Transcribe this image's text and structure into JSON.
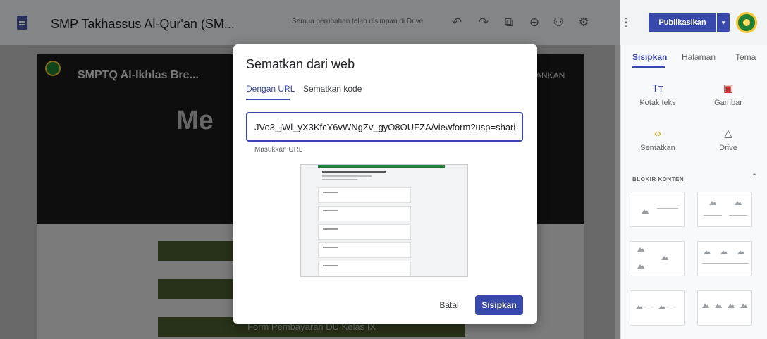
{
  "topbar": {
    "site_title": "SMP Takhassus Al-Qur'an (SM...",
    "save_status": "Semua perubahan telah disimpan di Drive",
    "undo_icon": "↶",
    "redo_icon": "↷",
    "preview_icon": "⧉",
    "link_icon": "⊖",
    "share_icon": "⚇",
    "settings_icon": "⚙",
    "more_icon": "⋮",
    "publish_label": "Publikasikan",
    "publish_dropdown_icon": "▾"
  },
  "site": {
    "header_title": "SMPTQ Al-Ikhlas Bre...",
    "nav_item": "BANKAN",
    "hero_text": "Me",
    "buttons": [
      "",
      "",
      "Form Pembayaran DU Kelas IX"
    ]
  },
  "panel": {
    "tabs": [
      "Sisipkan",
      "Halaman",
      "Tema"
    ],
    "tools": [
      {
        "label": "Kotak teks",
        "icon": "Tт",
        "color": "#3949ab"
      },
      {
        "label": "Gambar",
        "icon": "▣",
        "color": "#c62828"
      },
      {
        "label": "Sematkan",
        "icon": "‹›",
        "color": "#e6a100"
      },
      {
        "label": "Drive",
        "icon": "△",
        "color": "#5f6368"
      }
    ],
    "section_title": "BLOKIR KONTEN",
    "section_chevron": "⌃"
  },
  "dialog": {
    "title": "Sematkan dari web",
    "tab_url": "Dengan URL",
    "tab_code": "Sematkan kode",
    "url_value": "JVo3_jWl_yX3KfcY6vWNgZv_gyO8OUFZA/viewform?usp=sharing",
    "url_hint": "Masukkan URL",
    "cancel_label": "Batal",
    "insert_label": "Sisipkan"
  },
  "colors": {
    "accent": "#3949ab",
    "hero_bg": "#1a1a1a",
    "button_green": "#4a5a2e"
  }
}
